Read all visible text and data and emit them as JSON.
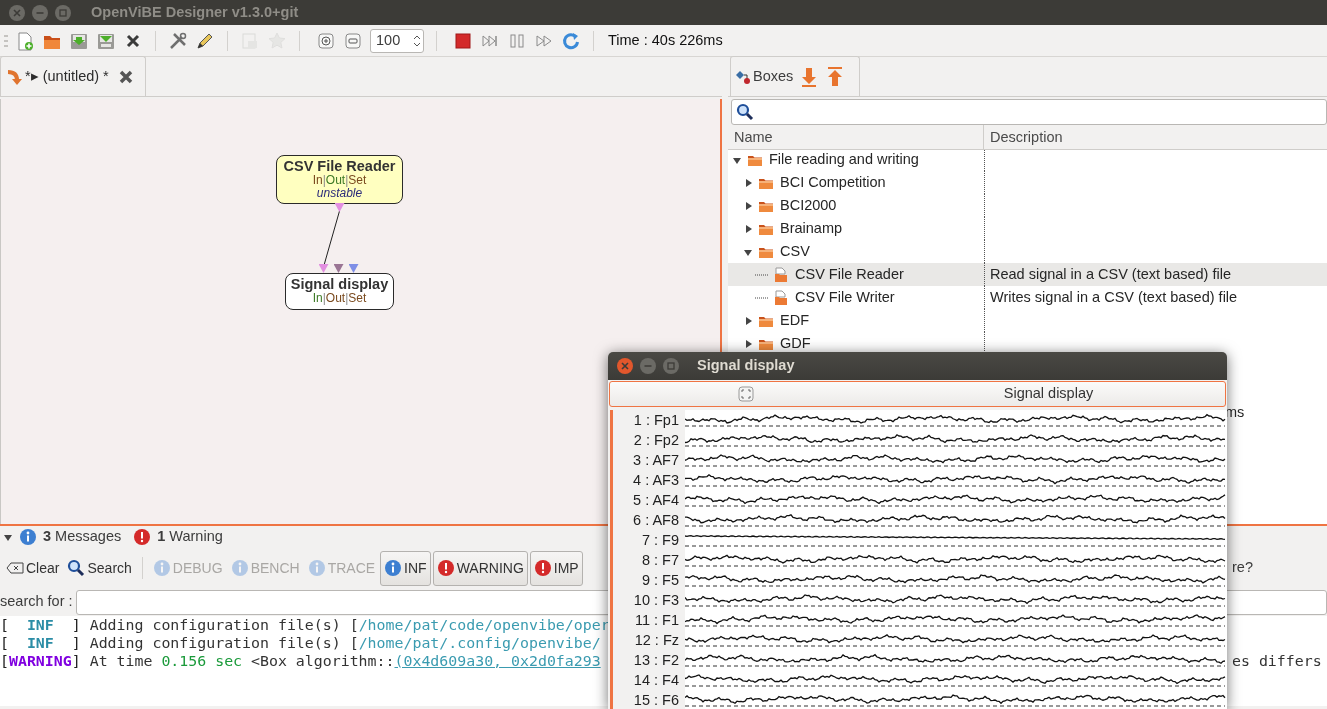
{
  "window": {
    "title": "OpenViBE Designer v1.3.0+git"
  },
  "toolbar": {
    "items": [
      {
        "kind": "new",
        "disabled": false
      },
      {
        "kind": "open",
        "disabled": false
      },
      {
        "kind": "save",
        "disabled": false
      },
      {
        "kind": "save-as",
        "disabled": false
      },
      {
        "kind": "close",
        "disabled": false
      },
      {
        "kind": "separator"
      },
      {
        "kind": "tools",
        "disabled": false
      },
      {
        "kind": "pencil",
        "disabled": false
      },
      {
        "kind": "separator"
      },
      {
        "kind": "metabox",
        "disabled": true
      },
      {
        "kind": "star",
        "disabled": true
      },
      {
        "kind": "separator"
      },
      {
        "kind": "zoom-in",
        "disabled": false
      },
      {
        "kind": "zoom-out",
        "disabled": false
      },
      {
        "kind": "spin",
        "value": "100"
      },
      {
        "kind": "separator"
      },
      {
        "kind": "stop",
        "disabled": false
      },
      {
        "kind": "step",
        "disabled": false
      },
      {
        "kind": "pause",
        "disabled": false
      },
      {
        "kind": "fast-forward",
        "disabled": false
      },
      {
        "kind": "refresh",
        "disabled": false
      },
      {
        "kind": "separator"
      },
      {
        "kind": "time",
        "text": "Time : 40s 226ms"
      }
    ]
  },
  "scenario_tab": {
    "label": "*▸ (untitled) *",
    "selected": true
  },
  "canvas": {
    "boxes": [
      {
        "title": "CSV File Reader",
        "unstable": true,
        "status": "unstable",
        "io": [
          {
            "text": "In",
            "color": "#7a4a1e"
          },
          {
            "text": "|"
          },
          {
            "text": "Out",
            "color": "#3d7a26"
          },
          {
            "text": "|"
          },
          {
            "text": "Set",
            "color": "#7a4a1e"
          }
        ],
        "outputs": [
          {
            "color": "#e28fe0"
          }
        ]
      },
      {
        "title": "Signal display",
        "unstable": false,
        "io": [
          {
            "text": "In",
            "color": "#3d7a26"
          },
          {
            "text": "|"
          },
          {
            "text": "Out",
            "color": "#7a4a1e"
          },
          {
            "text": "|"
          },
          {
            "text": "Set",
            "color": "#7a4a1e"
          }
        ],
        "inputs": [
          {
            "color": "#e28fe0"
          },
          {
            "color": "#9a7594"
          },
          {
            "color": "#7f8fe6"
          }
        ]
      }
    ]
  },
  "boxes_panel": {
    "tab": {
      "label": "Boxes",
      "selected": true
    },
    "columns": [
      "Name",
      "Description"
    ],
    "tree": [
      {
        "label": "File reading and writing",
        "kind": "folder",
        "expanded": true,
        "selected": false,
        "children": [
          {
            "label": "BCI Competition",
            "kind": "folder",
            "expanded": false,
            "selected": false
          },
          {
            "label": "BCI2000",
            "kind": "folder",
            "expanded": false,
            "selected": false
          },
          {
            "label": "Brainamp",
            "kind": "folder",
            "expanded": false,
            "selected": false
          },
          {
            "label": "CSV",
            "kind": "folder",
            "expanded": true,
            "selected": false,
            "children": [
              {
                "label": "CSV File Reader",
                "kind": "box",
                "selected": true,
                "description": "Read signal in a CSV (text based) file"
              },
              {
                "label": "CSV File Writer",
                "kind": "box",
                "selected": false,
                "description": "Writes signal in a CSV (text based) file"
              }
            ]
          },
          {
            "label": "EDF",
            "kind": "folder",
            "expanded": false,
            "selected": false
          },
          {
            "label": "GDF",
            "kind": "folder",
            "expanded": false,
            "selected": false
          }
        ]
      }
    ],
    "partial_description": "ms"
  },
  "messages": {
    "expanded": true,
    "info_count": "3",
    "info_label": "Messages",
    "warning_count": "1",
    "warning_label": "Warning",
    "filters": [
      {
        "kind": "clear",
        "label": "Clear"
      },
      {
        "kind": "search",
        "label": "Search"
      },
      {
        "kind": "separator"
      },
      {
        "kind": "info-toggle",
        "label": "DEBUG",
        "on": false
      },
      {
        "kind": "info-toggle",
        "label": "BENCH",
        "on": false
      },
      {
        "kind": "info-toggle",
        "label": "TRACE",
        "on": false
      },
      {
        "kind": "info-toggle",
        "label": "INF",
        "on": true
      },
      {
        "kind": "error-toggle",
        "label": "WARNING",
        "on": true
      },
      {
        "kind": "error-toggle",
        "label": "IMP",
        "on": true
      }
    ],
    "toolbar_fragment": "re?",
    "search_label": "search for :",
    "log": [
      {
        "segments": [
          {
            "kind": "bracket",
            "text": "["
          },
          {
            "kind": "info-level",
            "text": "  INF  "
          },
          {
            "kind": "bracket",
            "text": "]"
          },
          {
            "kind": "plain",
            "text": " Adding configuration file(s) ["
          },
          {
            "kind": "path",
            "text": "/home/pat/code/openvibe/oper"
          }
        ]
      },
      {
        "segments": [
          {
            "kind": "bracket",
            "text": "["
          },
          {
            "kind": "info-level",
            "text": "  INF  "
          },
          {
            "kind": "bracket",
            "text": "]"
          },
          {
            "kind": "plain",
            "text": " Adding configuration file(s) ["
          },
          {
            "kind": "path",
            "text": "/home/pat/.config/openvibe/"
          }
        ]
      },
      {
        "segments": [
          {
            "kind": "bracket",
            "text": "["
          },
          {
            "kind": "warning-level",
            "text": "WARNING"
          },
          {
            "kind": "bracket",
            "text": "]"
          },
          {
            "kind": "plain",
            "text": " At time "
          },
          {
            "kind": "time",
            "text": "0.156 sec"
          },
          {
            "kind": "plain",
            "text": " <Box algorithm::"
          },
          {
            "kind": "link",
            "text": "(0x4d609a30, 0x2d0fa293"
          }
        ],
        "tail": "es differs"
      }
    ]
  },
  "signal_window": {
    "title": "Signal display",
    "header": "Signal display",
    "channels": [
      "1 : Fp1",
      "2 : Fp2",
      "3 : AF7",
      "4 : AF3",
      "5 : AF4",
      "6 : AF8",
      "7 : F9",
      "8 : F7",
      "9 : F5",
      "10 : F3",
      "11 : F1",
      "12 : Fz",
      "13 : F2",
      "14 : F4",
      "15 : F6"
    ]
  }
}
